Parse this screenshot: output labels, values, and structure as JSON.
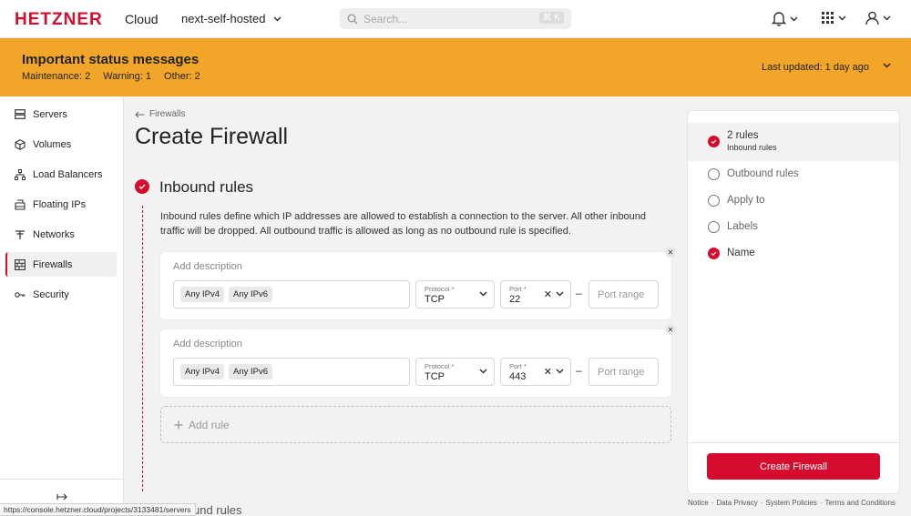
{
  "header": {
    "logo": "HETZNER",
    "logo_suffix": "Cloud",
    "project": "next-self-hosted",
    "search_placeholder": "Search...",
    "search_shortcut": "⌘ K"
  },
  "banner": {
    "title": "Important status messages",
    "maintenance": "Maintenance: 2",
    "warning": "Warning: 1",
    "other": "Other: 2",
    "last_updated": "Last updated: 1 day ago"
  },
  "sidebar": {
    "items": [
      {
        "label": "Servers",
        "icon": "server-icon"
      },
      {
        "label": "Volumes",
        "icon": "cube-icon"
      },
      {
        "label": "Load Balancers",
        "icon": "load-balancer-icon"
      },
      {
        "label": "Floating IPs",
        "icon": "floating-ip-icon"
      },
      {
        "label": "Networks",
        "icon": "network-icon"
      },
      {
        "label": "Firewalls",
        "icon": "firewall-icon"
      },
      {
        "label": "Security",
        "icon": "key-icon"
      }
    ],
    "active": "Firewalls"
  },
  "main": {
    "breadcrumb": "Firewalls",
    "title": "Create Firewall",
    "section_title": "Inbound rules",
    "section_desc": "Inbound rules define which IP addresses are allowed to establish a connection to the server. All other inbound traffic will be dropped. All outbound traffic is allowed as long as no outbound rule is specified.",
    "rules": [
      {
        "description_placeholder": "Add description",
        "sources": [
          "Any IPv4",
          "Any IPv6"
        ],
        "protocol_label": "Protocol *",
        "protocol": "TCP",
        "port_label": "Port *",
        "port": "22",
        "port_range_placeholder": "Port range"
      },
      {
        "description_placeholder": "Add description",
        "sources": [
          "Any IPv4",
          "Any IPv6"
        ],
        "protocol_label": "Protocol *",
        "protocol": "TCP",
        "port_label": "Port *",
        "port": "443",
        "port_range_placeholder": "Port range"
      }
    ],
    "add_rule": "Add rule",
    "next_section": "und rules"
  },
  "steps": {
    "items": [
      {
        "label": "2 rules",
        "sub": "Inbound rules",
        "done": true,
        "active": true
      },
      {
        "label": "Outbound rules",
        "done": false
      },
      {
        "label": "Apply to",
        "done": false
      },
      {
        "label": "Labels",
        "done": false
      },
      {
        "label": "Name",
        "done": true
      }
    ],
    "create_button": "Create Firewall"
  },
  "footer": {
    "links": [
      "Notice",
      "Data Privacy",
      "System Policies",
      "Terms and Conditions"
    ],
    "status_url": "https://console.hetzner.cloud/projects/3133481/servers"
  },
  "colors": {
    "brand": "#d50c2d",
    "banner": "#f1a629"
  }
}
